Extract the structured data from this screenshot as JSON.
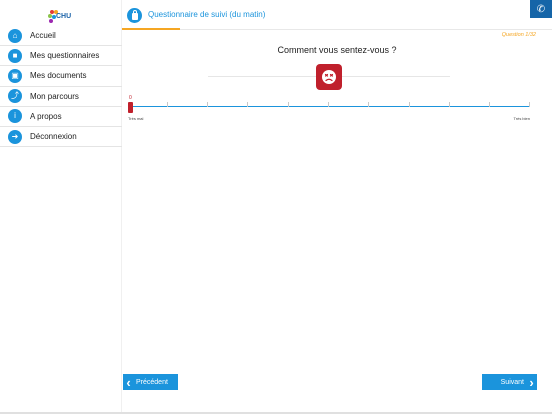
{
  "logo": {
    "text": "CHU"
  },
  "sidebar": {
    "items": [
      {
        "label": "Accueil",
        "icon": "home-icon"
      },
      {
        "label": "Mes questionnaires",
        "icon": "lock-icon"
      },
      {
        "label": "Mes documents",
        "icon": "camera-icon"
      },
      {
        "label": "Mon parcours",
        "icon": "route-icon"
      },
      {
        "label": "A propos",
        "icon": "info-icon"
      },
      {
        "label": "Déconnexion",
        "icon": "logout-icon"
      }
    ]
  },
  "header": {
    "title": "Questionnaire de suivi (du matin)",
    "progress": "Question 1/32"
  },
  "question": {
    "text": "Comment vous sentez-vous ?",
    "mood_icon": "sad-face-icon",
    "slider": {
      "value": "0",
      "min_label": "Très mal",
      "max_label": "Très bien"
    }
  },
  "footer": {
    "prev_label": "Précédent",
    "next_label": "Suivant"
  },
  "colors": {
    "accent": "#1b94dc",
    "highlight": "#f5a623",
    "danger": "#c0202c"
  }
}
